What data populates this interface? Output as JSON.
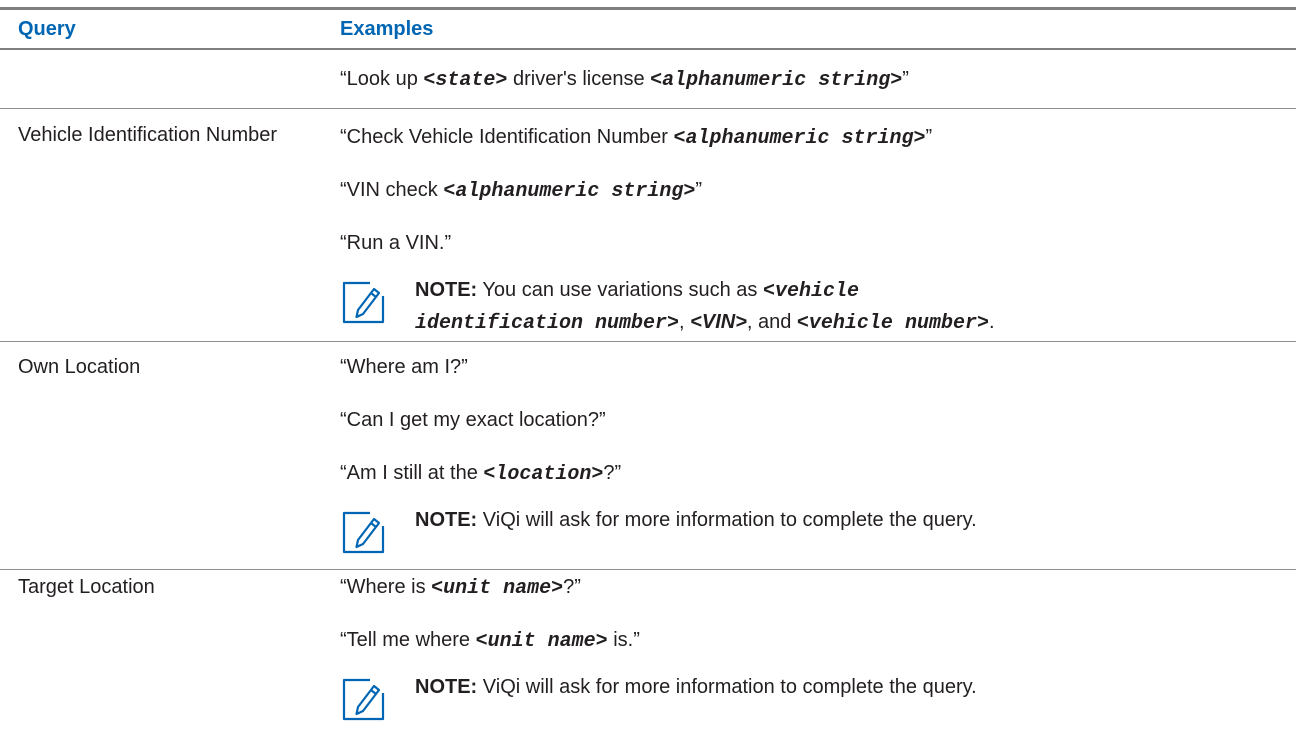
{
  "table": {
    "headers": {
      "query": "Query",
      "examples": "Examples"
    },
    "rows": [
      {
        "query": "",
        "example1": {
          "pre": "“Look up ",
          "term1": "<state>",
          "mid": " driver's license ",
          "term2": "<alphanumeric string>",
          "post": "”"
        }
      },
      {
        "query": "Vehicle Identification Number",
        "example1": {
          "pre": "“Check Vehicle Identification Number ",
          "term": "<alphanumeric string>",
          "post": "”"
        },
        "example2": {
          "pre": "“VIN check ",
          "term": "<alphanumeric string>",
          "post": "”"
        },
        "example3": "“Run a VIN.”",
        "note": {
          "label": "NOTE:",
          "line1_pre": " You can use variations such as ",
          "line1_term": "<vehicle",
          "line2_term1": "identification number>",
          "line2_sep1": ", ",
          "line2_term2": "<VIN>",
          "line2_sep2": ", and ",
          "line2_term3": "<vehicle number>",
          "line2_post": "."
        }
      },
      {
        "query": "Own Location",
        "example1": "“Where am I?”",
        "example2": "“Can I get my exact location?”",
        "example3": {
          "pre": "“Am I still at the ",
          "term": "<location>",
          "post": "?”"
        },
        "note": {
          "label": "NOTE:",
          "text": " ViQi will ask for more information to complete the query."
        }
      },
      {
        "query": "Target Location",
        "example1": {
          "pre": "“Where is ",
          "term": "<unit name>",
          "post": "?”"
        },
        "example2": {
          "pre": "“Tell me where ",
          "term": "<unit name>",
          "post": " is.”"
        },
        "note": {
          "label": "NOTE:",
          "text": " ViQi will ask for more information to complete the query."
        }
      }
    ]
  },
  "colors": {
    "header_text": "#0066b3",
    "icon": "#0066b3",
    "rule": "#7f7f7f",
    "text": "#231f20"
  },
  "icons": [
    "note-icon"
  ]
}
